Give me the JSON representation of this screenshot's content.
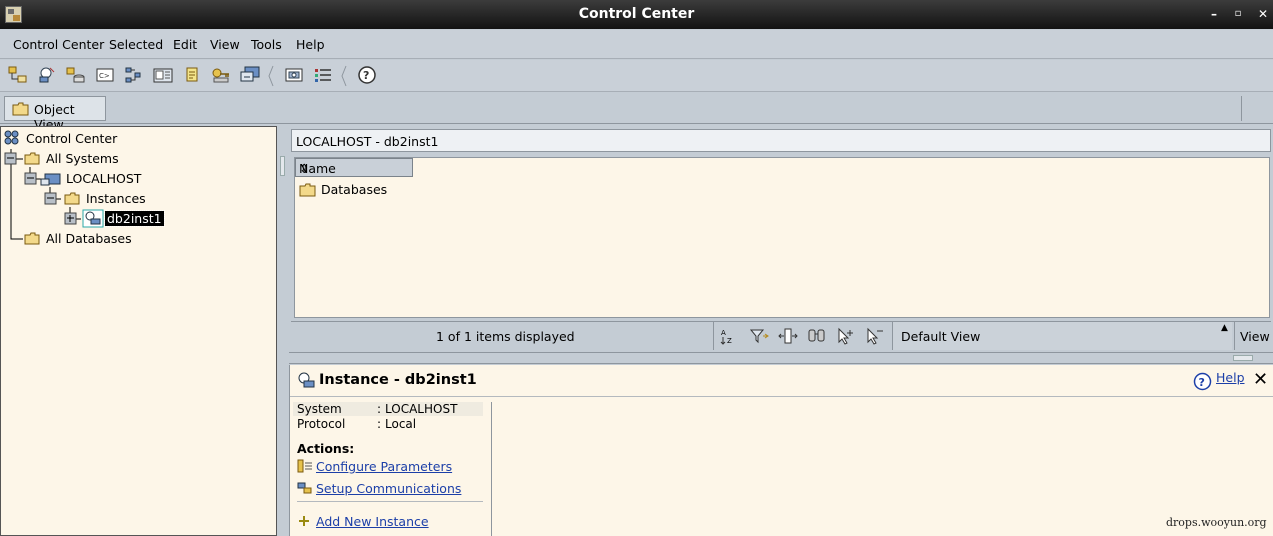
{
  "window": {
    "title": "Control Center"
  },
  "menu": [
    "Control Center",
    "Selected",
    "Edit",
    "View",
    "Tools",
    "Help"
  ],
  "toolbar": {
    "icons": [
      "system-icon",
      "instance-icon",
      "database-icon",
      "command-editor-icon",
      "task-center-icon",
      "journal-icon",
      "notes-icon",
      "license-icon",
      "health-center-icon",
      "configure-icon",
      "contents-icon",
      "help-icon"
    ]
  },
  "tabs": [
    {
      "label": "Object View"
    }
  ],
  "tree": {
    "root": "Control Center",
    "all_systems": "All Systems",
    "localhost": "LOCALHOST",
    "instances": "Instances",
    "selected": "db2inst1",
    "all_databases": "All Databases"
  },
  "contents": {
    "breadcrumb": "LOCALHOST - db2inst1",
    "column_header": "Name",
    "items": [
      {
        "name": "Databases"
      }
    ],
    "status": "1 of 1 items displayed",
    "view_combo": "Default View",
    "view_button": "View"
  },
  "details": {
    "title": "Instance - db2inst1",
    "help": "Help",
    "properties": [
      {
        "key": "System",
        "value": "LOCALHOST"
      },
      {
        "key": "Protocol",
        "value": "Local"
      }
    ],
    "actions_title": "Actions:",
    "actions": [
      "Configure Parameters",
      "Setup Communications",
      "Add New Instance"
    ]
  },
  "watermark": "drops.wooyun.org",
  "colors": {
    "titlebar": "#1e1e1e",
    "chrome": "#c9d0d8",
    "pane_bg": "#fdf6e8",
    "link": "#1c3fa8",
    "selection": "#000000"
  }
}
